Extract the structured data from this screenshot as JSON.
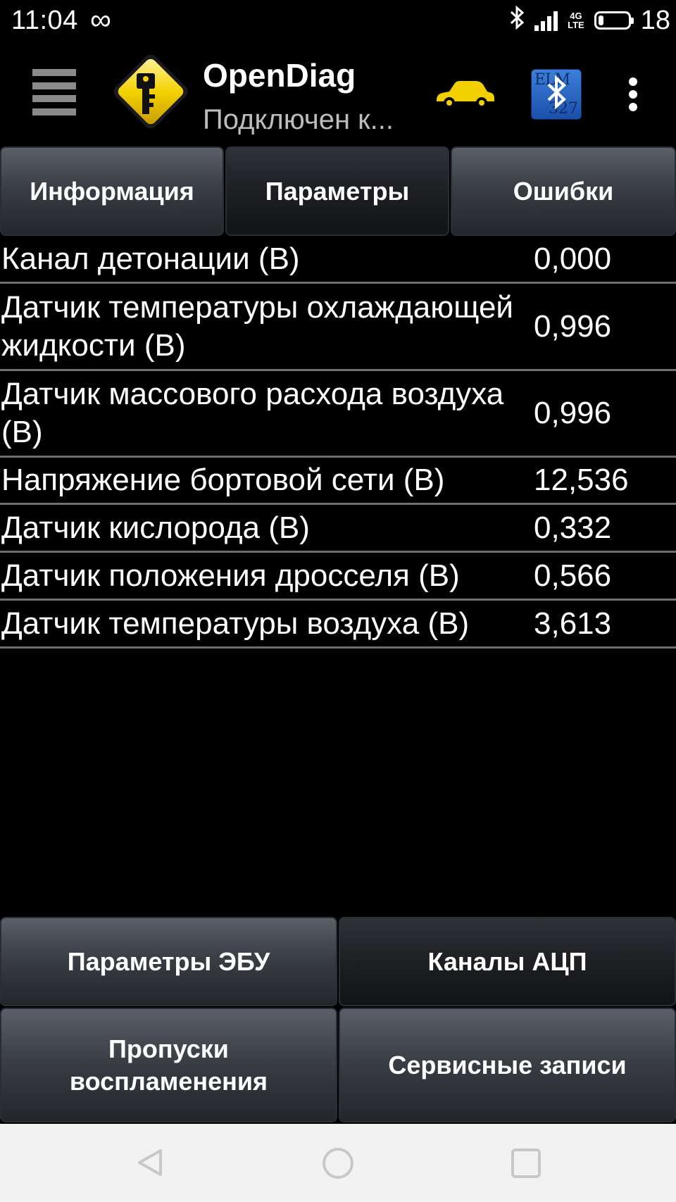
{
  "status_bar": {
    "time": "11:04",
    "loop_icon": "infinity-icon",
    "network": "4G LTE",
    "battery_level": "18",
    "battery_fraction": 0.18
  },
  "app_bar": {
    "title": "OpenDiag",
    "subtitle": "Подключен к...",
    "logo_color": "#f3d200",
    "car_color": "#f2d000"
  },
  "tabs": [
    {
      "label": "Информация",
      "selected": false
    },
    {
      "label": "Параметры",
      "selected": true
    },
    {
      "label": "Ошибки",
      "selected": false
    }
  ],
  "params": [
    {
      "label": "Канал детонации (В)",
      "value": "0,000"
    },
    {
      "label": "Датчик температуры охлаждающей жидкости (В)",
      "value": "0,996"
    },
    {
      "label": "Датчик массового расхода воздуха (В)",
      "value": "0,996"
    },
    {
      "label": "Напряжение бортовой сети (В)",
      "value": "12,536"
    },
    {
      "label": "Датчик кислорода (В)",
      "value": "0,332"
    },
    {
      "label": "Датчик положения дросселя (В)",
      "value": "0,566"
    },
    {
      "label": "Датчик температуры воздуха (В)",
      "value": "3,613"
    }
  ],
  "bottom_buttons": [
    {
      "label": "Параметры ЭБУ",
      "selected": false
    },
    {
      "label": "Каналы АЦП",
      "selected": true
    },
    {
      "label": "Пропуски воспламенения",
      "selected": false
    },
    {
      "label": "Сервисные записи",
      "selected": false
    }
  ],
  "nav_bar": {
    "back": "back-icon",
    "home": "home-icon",
    "recents": "recents-icon"
  }
}
